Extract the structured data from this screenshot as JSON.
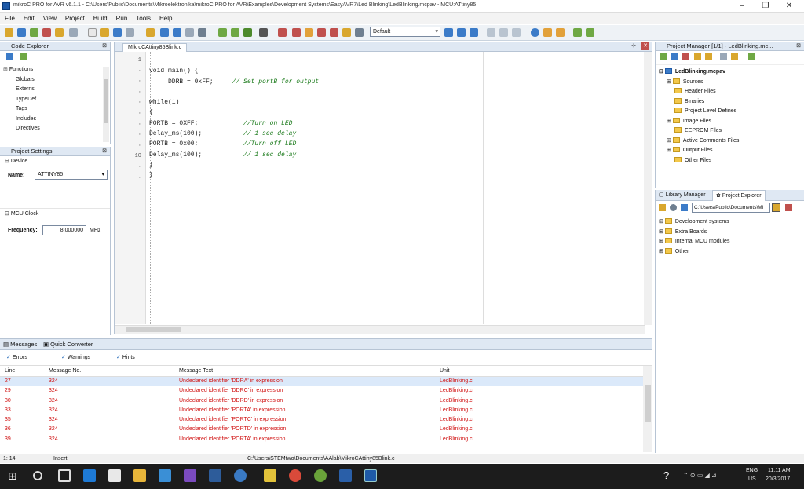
{
  "window": {
    "title": "mikroC PRO for AVR v6.1.1 - C:\\Users\\Public\\Documents\\Mikroelektronika\\mikroC PRO for AVR\\Examples\\Development Systems\\EasyAVR7\\Led Blinking\\LedBlinking.mcpav - MCU:ATtiny85"
  },
  "menu": [
    "File",
    "Edit",
    "View",
    "Project",
    "Build",
    "Run",
    "Tools",
    "Help"
  ],
  "toolbar": {
    "build_config": "Default"
  },
  "code_explorer": {
    "title": "Code Explorer",
    "items": [
      "Functions",
      "Globals",
      "Externs",
      "TypeDef",
      "Tags",
      "Includes",
      "Directives"
    ]
  },
  "project_settings": {
    "title": "Project Settings",
    "device_header": "Device",
    "name_label": "Name:",
    "name_value": "ATTINY85",
    "clock_header": "MCU Clock",
    "freq_label": "Frequency:",
    "freq_value": "8.000000",
    "freq_unit": "MHz"
  },
  "editor": {
    "tab": "MikroCAttiny85Blink.c",
    "line_numbers": [
      "1",
      "",
      "",
      "",
      "",
      "",
      "",
      "",
      "",
      "10",
      "",
      ""
    ],
    "lines": [
      "void main() {",
      "     DDRB = 0xFF;     // Set portB for output",
      "",
      "while(1)",
      "{",
      "PORTB = 0XFF;            //Turn on LED",
      "Delay_ms(100);           // 1 sec delay",
      "PORTB = 0x00;            //Turn off LED",
      "Delay_ms(100);           // 1 sec delay",
      "}",
      "}"
    ]
  },
  "project_manager": {
    "title": "Project Manager [1/1] - LedBlinking.mc...",
    "root": "LedBlinking.mcpav",
    "items": [
      "Sources",
      "Header Files",
      "Binaries",
      "Project Level Defines",
      "Image Files",
      "EEPROM Files",
      "Active Comments Files",
      "Output Files",
      "Other Files"
    ]
  },
  "explorer": {
    "tabs": [
      "Library Manager",
      "Project Explorer"
    ],
    "path": "C:\\Users\\Public\\Documents\\Mi",
    "items": [
      "Development systems",
      "Extra Boards",
      "Internal MCU modules",
      "Other"
    ]
  },
  "messages": {
    "tabs": [
      "Messages",
      "Quick Converter"
    ],
    "filters": [
      "Errors",
      "Warnings",
      "Hints"
    ],
    "columns": [
      "Line",
      "Message No.",
      "Message Text",
      "Unit"
    ],
    "rows": [
      {
        "line": "27",
        "no": "324",
        "text": "Undeclared identifier 'DDRA' in expression",
        "unit": "LedBlinking.c"
      },
      {
        "line": "29",
        "no": "324",
        "text": "Undeclared identifier 'DDRC' in expression",
        "unit": "LedBlinking.c"
      },
      {
        "line": "30",
        "no": "324",
        "text": "Undeclared identifier 'DDRD' in expression",
        "unit": "LedBlinking.c"
      },
      {
        "line": "33",
        "no": "324",
        "text": "Undeclared identifier 'PORTA' in expression",
        "unit": "LedBlinking.c"
      },
      {
        "line": "35",
        "no": "324",
        "text": "Undeclared identifier 'PORTC' in expression",
        "unit": "LedBlinking.c"
      },
      {
        "line": "36",
        "no": "324",
        "text": "Undeclared identifier 'PORTD' in expression",
        "unit": "LedBlinking.c"
      },
      {
        "line": "39",
        "no": "324",
        "text": "Undeclared identifier 'PORTA' in expression",
        "unit": "LedBlinking.c"
      }
    ]
  },
  "statusbar": {
    "pos": "1: 14",
    "mode": "Insert",
    "file": "C:\\Users\\STEMtwo\\Documents\\AAlab\\MikroCAttiny85Blink.c"
  },
  "taskbar": {
    "lang": "ENG",
    "region": "US",
    "time": "11:11 AM",
    "date": "20/3/2017"
  }
}
